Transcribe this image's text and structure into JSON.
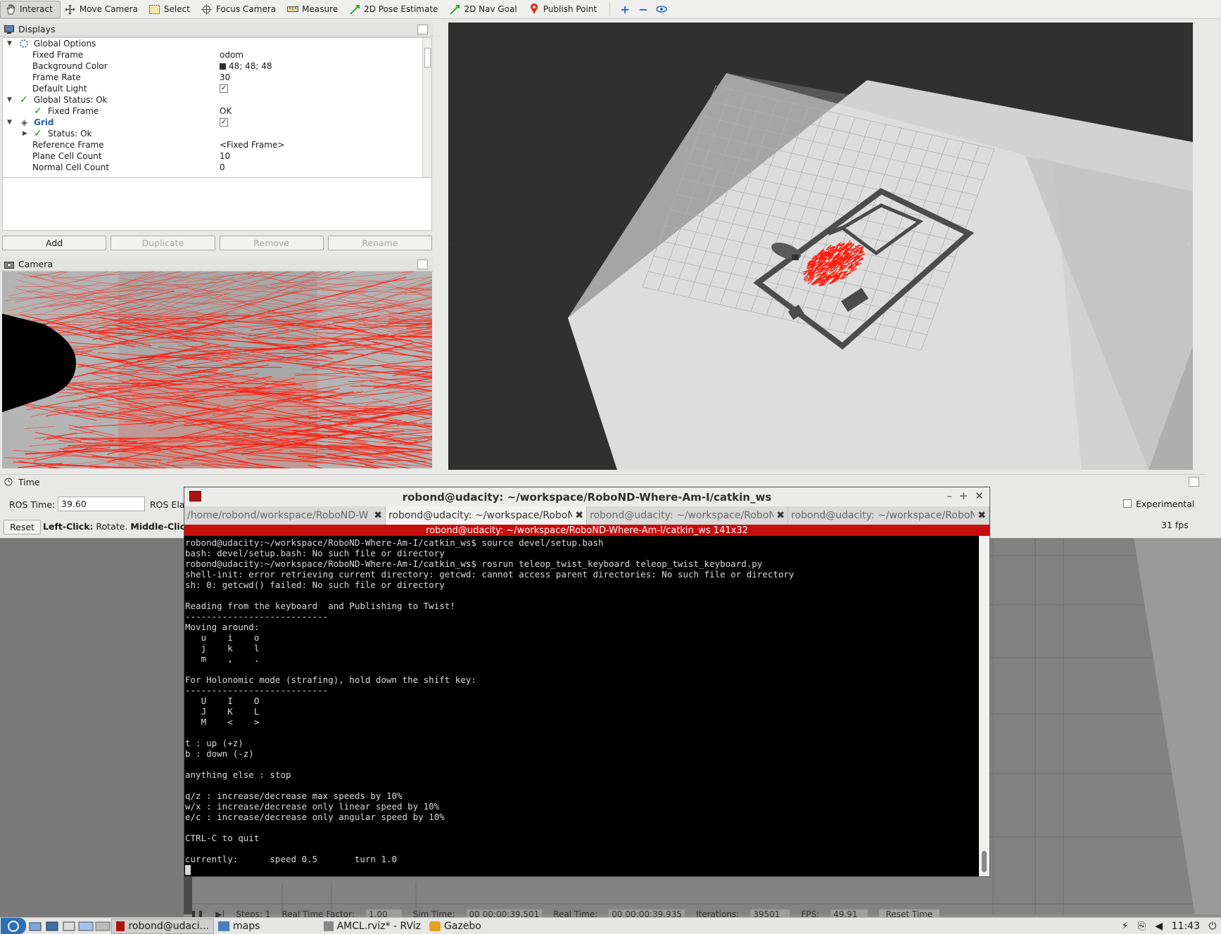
{
  "toolbar": {
    "tools": [
      "Interact",
      "Move Camera",
      "Select",
      "Focus Camera",
      "Measure",
      "2D Pose Estimate",
      "2D Nav Goal",
      "Publish Point"
    ]
  },
  "displays": {
    "title": "Displays",
    "rows": [
      {
        "name": "Global Options",
        "value": ""
      },
      {
        "name": "Fixed Frame",
        "value": "odom"
      },
      {
        "name": "Background Color",
        "value": "48; 48; 48"
      },
      {
        "name": "Frame Rate",
        "value": "30"
      },
      {
        "name": "Default Light",
        "value": ""
      },
      {
        "name": "Global Status: Ok",
        "value": ""
      },
      {
        "name": "Fixed Frame",
        "value": "OK"
      },
      {
        "name": "Grid",
        "value": ""
      },
      {
        "name": "Status: Ok",
        "value": ""
      },
      {
        "name": "Reference Frame",
        "value": "<Fixed Frame>"
      },
      {
        "name": "Plane Cell Count",
        "value": "10"
      },
      {
        "name": "Normal Cell Count",
        "value": "0"
      }
    ],
    "buttons": [
      "Add",
      "Duplicate",
      "Remove",
      "Rename"
    ]
  },
  "camera": {
    "title": "Camera"
  },
  "time": {
    "title": "Time",
    "ros_time_label": "ROS Time:",
    "ros_time_value": "39.60",
    "ros_elapsed_label": "ROS Ela",
    "experimental_label": "Experimental",
    "reset_label": "Reset",
    "hint_bold1": "Left-Click:",
    "hint_text1": " Rotate. ",
    "hint_bold2": "Middle-Click",
    "fps": "31 fps"
  },
  "terminal": {
    "title": "robond@udacity: ~/workspace/RoboND-Where-Am-I/catkin_ws",
    "tabs": [
      "/home/robond/workspace/RoboND-W",
      "robond@udacity: ~/workspace/RoboN",
      "robond@udacity: ~/workspace/RoboN",
      "robond@udacity: ~/workspace/RoboN"
    ],
    "subtitle": "robond@udacity: ~/workspace/RoboND-Where-Am-I/catkin_ws 141x32",
    "lines": [
      "robond@udacity:~/workspace/RoboND-Where-Am-I/catkin_ws$ source devel/setup.bash",
      "bash: devel/setup.bash: No such file or directory",
      "robond@udacity:~/workspace/RoboND-Where-Am-I/catkin_ws$ rosrun teleop_twist_keyboard teleop_twist_keyboard.py",
      "shell-init: error retrieving current directory: getcwd: cannot access parent directories: No such file or directory",
      "sh: 0: getcwd() failed: No such file or directory",
      "",
      "Reading from the keyboard  and Publishing to Twist!",
      "---------------------------",
      "Moving around:",
      "   u    i    o",
      "   j    k    l",
      "   m    ,    .",
      "",
      "For Holonomic mode (strafing), hold down the shift key:",
      "---------------------------",
      "   U    I    O",
      "   J    K    L",
      "   M    <    >",
      "",
      "t : up (+z)",
      "b : down (-z)",
      "",
      "anything else : stop",
      "",
      "q/z : increase/decrease max speeds by 10%",
      "w/x : increase/decrease only linear speed by 10%",
      "e/c : increase/decrease only angular speed by 10%",
      "",
      "CTRL-C to quit",
      "",
      "currently:      speed 0.5       turn 1.0"
    ]
  },
  "gazebo_status": {
    "steps": "Steps: 1",
    "rtf_label": "Real Time Factor:",
    "rtf_value": "1.00",
    "sim_label": "Sim Time:",
    "sim_value": "00 00:00:39.501",
    "real_label": "Real Time:",
    "real_value": "00 00:00:39.935",
    "iter_label": "Iterations:",
    "iter_value": "39501",
    "fps_label": "FPS:",
    "fps_value": "49.91",
    "reset_label": "Reset Time"
  },
  "taskbar": {
    "items": [
      "robond@udaci...",
      "maps",
      "AMCL.rviz* - RViz",
      "Gazebo"
    ],
    "clock": "11:43"
  },
  "colors": {
    "rviz_bg": "#303030",
    "particle_red": "#ff1a0a",
    "terminal_accent": "#c80d0d"
  }
}
